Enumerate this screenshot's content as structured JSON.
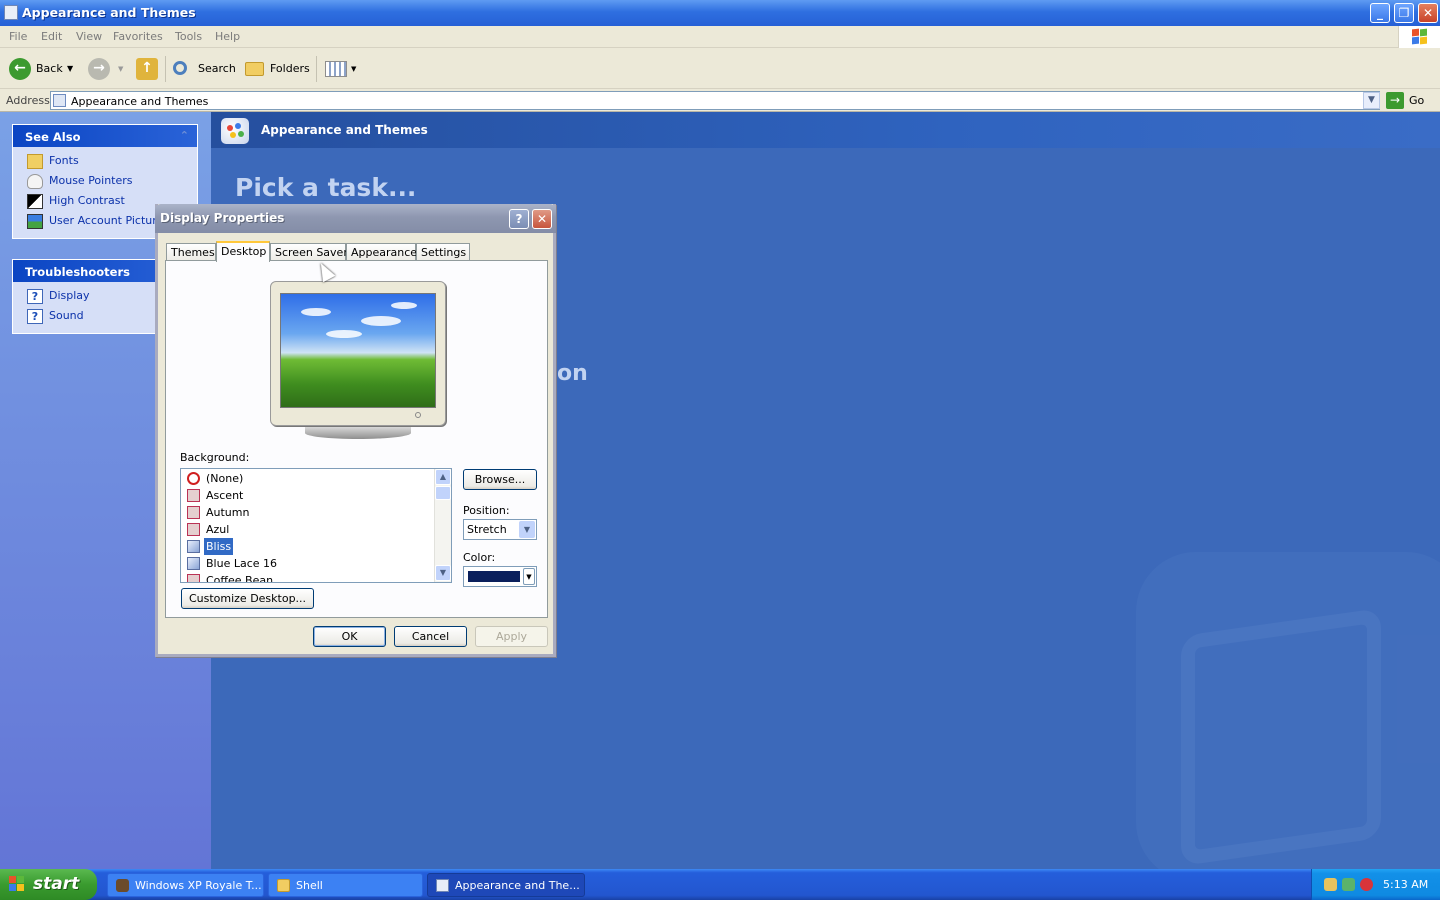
{
  "window": {
    "title": "Appearance and Themes",
    "controls": {
      "minimize": "_",
      "restore": "❐",
      "close": "✕"
    }
  },
  "menu": [
    "File",
    "Edit",
    "View",
    "Favorites",
    "Tools",
    "Help"
  ],
  "toolbar": {
    "back_label": "Back",
    "search_label": "Search",
    "folders_label": "Folders",
    "icons": {
      "back": "back-arrow-icon",
      "forward": "forward-arrow-icon",
      "up": "up-folder-icon",
      "search": "magnifier-icon",
      "folders": "folders-icon",
      "views": "views-icon"
    }
  },
  "address": {
    "label": "Address",
    "value": "Appearance and Themes",
    "go_label": "Go"
  },
  "see_also": {
    "header": "See Also",
    "items": [
      {
        "label": "Fonts",
        "icon": "fonts-folder-icon"
      },
      {
        "label": "Mouse Pointers",
        "icon": "mouse-pointer-icon"
      },
      {
        "label": "High Contrast",
        "icon": "high-contrast-icon"
      },
      {
        "label": "User Account Picture",
        "icon": "user-picture-icon"
      }
    ]
  },
  "troubleshooters": {
    "header": "Troubleshooters",
    "items": [
      {
        "label": "Display",
        "icon": "help-icon"
      },
      {
        "label": "Sound",
        "icon": "help-icon"
      }
    ]
  },
  "content": {
    "header_title": "Appearance and Themes",
    "pick_task": "Pick a task...",
    "partial_heading": "on"
  },
  "dialog": {
    "title": "Display Properties",
    "tabs": [
      "Themes",
      "Desktop",
      "Screen Saver",
      "Appearance",
      "Settings"
    ],
    "active_tab": "Desktop",
    "background_label": "Background:",
    "backgrounds": [
      "(None)",
      "Ascent",
      "Autumn",
      "Azul",
      "Bliss",
      "Blue Lace 16",
      "Coffee Bean"
    ],
    "selected_background": "Bliss",
    "browse_label": "Browse...",
    "position_label": "Position:",
    "position_value": "Stretch",
    "color_label": "Color:",
    "color_value": "#0a1f5c",
    "customize_label": "Customize Desktop...",
    "ok_label": "OK",
    "cancel_label": "Cancel",
    "apply_label": "Apply"
  },
  "taskbar": {
    "start_label": "start",
    "tasks": [
      {
        "label": "Windows XP Royale T...",
        "active": false
      },
      {
        "label": "Shell",
        "active": false
      },
      {
        "label": "Appearance and The...",
        "active": true
      }
    ],
    "clock": "5:13 AM"
  },
  "colors": {
    "accent": "#316ac5",
    "title_bar": "#2660d6",
    "task_pane": "#6a8ee0",
    "content_bg": "#3c69ba"
  }
}
